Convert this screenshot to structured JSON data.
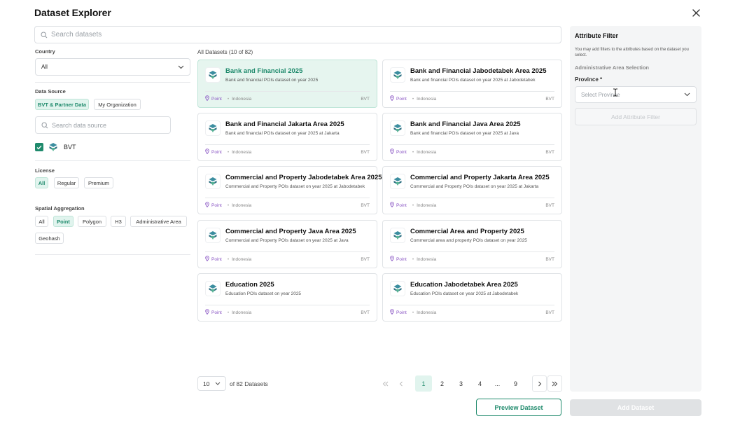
{
  "header": {
    "title": "Dataset Explorer"
  },
  "search": {
    "placeholder": "Search datasets"
  },
  "sidebar": {
    "country": {
      "label": "Country",
      "value": "All"
    },
    "data_source": {
      "label": "Data Source",
      "chips": [
        "BVT & Partner Data",
        "My Organization"
      ],
      "active": "BVT & Partner Data",
      "search_placeholder": "Search data source",
      "items": [
        {
          "label": "BVT",
          "checked": true
        }
      ]
    },
    "license": {
      "label": "License",
      "chips": [
        "All",
        "Regular",
        "Premium"
      ],
      "active": "All"
    },
    "spatial": {
      "label": "Spatial Aggregation",
      "chips": [
        "All",
        "Point",
        "Polygon",
        "H3",
        "Administrative Area",
        "Geohash"
      ],
      "active": "Point"
    }
  },
  "grid": {
    "header": "All Datasets (10 of 82)",
    "datasets": [
      {
        "title": "Bank and Financial 2025",
        "desc": "Bank and financial POIs dataset on year 2025",
        "type": "Point",
        "country": "Indonesia",
        "source": "BVT",
        "selected": true
      },
      {
        "title": "Bank and Financial Jabodetabek Area 2025",
        "desc": "Bank and financial POIs dataset on year 2025 at Jabodetabek",
        "type": "Point",
        "country": "Indonesia",
        "source": "BVT"
      },
      {
        "title": "Bank and Financial Jakarta Area 2025",
        "desc": "Bank and financial POIs dataset on year 2025 at Jakarta",
        "type": "Point",
        "country": "Indonesia",
        "source": "BVT"
      },
      {
        "title": "Bank and Financial Java Area 2025",
        "desc": "Bank and financial POIs dataset on year 2025 at Java",
        "type": "Point",
        "country": "Indonesia",
        "source": "BVT"
      },
      {
        "title": "Commercial and Property Jabodetabek Area 2025",
        "desc": "Commercial and Property POIs dataset on year 2025 at Jabodetabek",
        "type": "Point",
        "country": "Indonesia",
        "source": "BVT"
      },
      {
        "title": "Commercial and Property Jakarta Area 2025",
        "desc": "Commercial and Property POIs dataset on year 2025 at Jakarta",
        "type": "Point",
        "country": "Indonesia",
        "source": "BVT"
      },
      {
        "title": "Commercial and Property Java Area 2025",
        "desc": "Commercial and Property POIs dataset on year 2025 at Java",
        "type": "Point",
        "country": "Indonesia",
        "source": "BVT"
      },
      {
        "title": "Commercial Area and Property 2025",
        "desc": "Commercial area and property POIs dataset on year 2025",
        "type": "Point",
        "country": "Indonesia",
        "source": "BVT"
      },
      {
        "title": "Education 2025",
        "desc": "Education POIs dataset on year 2025",
        "type": "Point",
        "country": "Indonesia",
        "source": "BVT"
      },
      {
        "title": "Education Jabodetabek Area 2025",
        "desc": "Education POIs dataset on year 2025 at Jabodetabek",
        "type": "Point",
        "country": "Indonesia",
        "source": "BVT"
      }
    ]
  },
  "pagination": {
    "page_size": "10",
    "total_label": "of 82 Datasets",
    "pages": [
      "1",
      "2",
      "3",
      "4",
      "...",
      "9"
    ],
    "current": "1"
  },
  "actions": {
    "preview": "Preview Dataset",
    "add": "Add Dataset"
  },
  "attribute_filter": {
    "title": "Attribute Filter",
    "description": "You may add filters to the attributes based on the dataset you select.",
    "section": "Administrative Area Selection",
    "province_label": "Province *",
    "province_placeholder": "Select Province",
    "add_button": "Add Attribute Filter"
  },
  "colors": {
    "accent": "#1f8a6c",
    "accent_bg": "#e1f4ee",
    "point_type": "#8a56c4"
  },
  "icons": {
    "search": "search-icon",
    "close": "close-icon",
    "chevron": "chevron-down-icon",
    "dataset": "dataset-logo-icon",
    "point": "map-pin-icon"
  }
}
